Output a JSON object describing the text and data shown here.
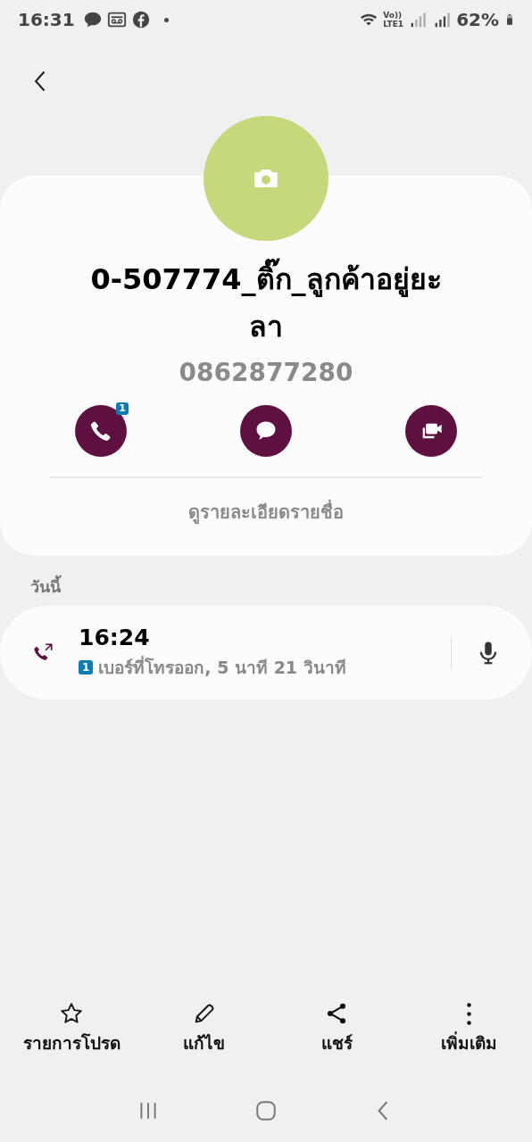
{
  "status_bar": {
    "time": "16:31",
    "network": "Vo))",
    "network_sub": "LTE1",
    "battery": "62%"
  },
  "contact": {
    "name": "0-507774_ติ๊ก_ลูกค้าอยู่ยะลา",
    "phone": "0862877280",
    "actions": [
      {
        "kind": "call",
        "badge": "1"
      },
      {
        "kind": "message"
      },
      {
        "kind": "video"
      }
    ],
    "details_link": "ดูรายละเอียดรายชื่อ"
  },
  "history": {
    "heading": "วันนี้",
    "entries": [
      {
        "kind": "outgoing",
        "time": "16:24",
        "sim": "1",
        "description": "เบอร์ที่โทรออก, 5 นาที 21 วินาที"
      }
    ]
  },
  "bottom_bar": [
    {
      "kind": "star",
      "label": "รายการโปรด"
    },
    {
      "kind": "edit",
      "label": "แก้ไข"
    },
    {
      "kind": "share",
      "label": "แชร์"
    },
    {
      "kind": "more",
      "label": "เพิ่มเติม"
    }
  ]
}
